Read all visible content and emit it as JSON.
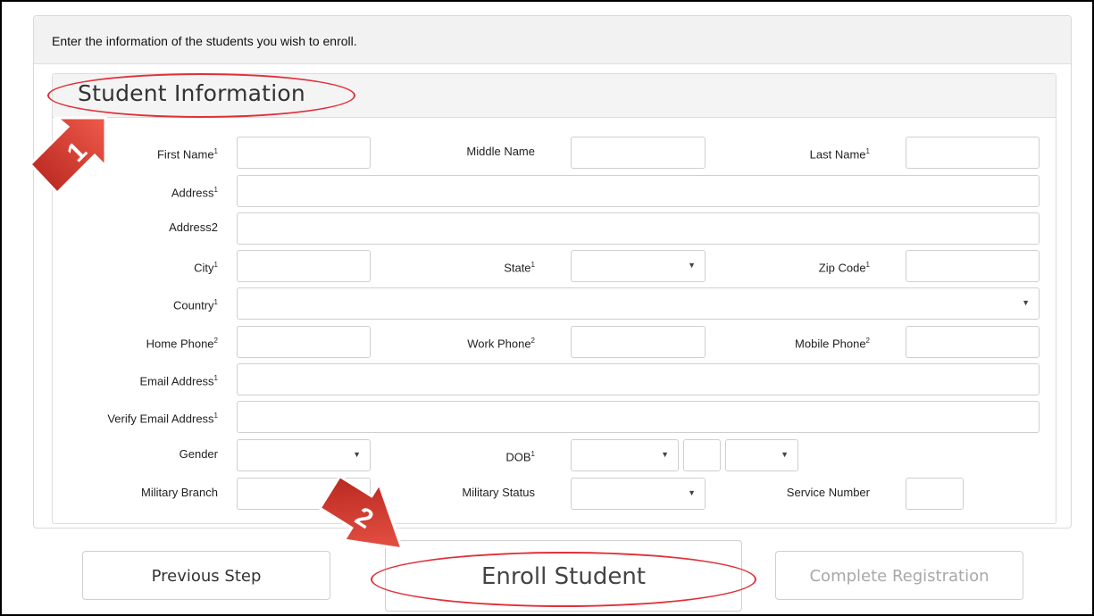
{
  "intro_text": "Enter the information of the students you wish to enroll.",
  "section_title": "Student Information",
  "required_mark": "1",
  "phone_mark": "2",
  "labels": {
    "first_name": "First Name",
    "middle_name": "Middle Name",
    "last_name": "Last Name",
    "address": "Address",
    "address2": "Address2",
    "city": "City",
    "state": "State",
    "zip_code": "Zip Code",
    "country": "Country",
    "home_phone": "Home Phone",
    "work_phone": "Work Phone",
    "mobile_phone": "Mobile Phone",
    "email": "Email Address",
    "verify_email": "Verify Email Address",
    "gender": "Gender",
    "dob": "DOB",
    "military_branch": "Military Branch",
    "military_status": "Military Status",
    "service_number": "Service Number"
  },
  "buttons": {
    "previous": "Previous Step",
    "enroll": "Enroll Student",
    "complete": "Complete Registration"
  },
  "callouts": {
    "one": "1",
    "two": "2"
  },
  "colors": {
    "highlight": "#e0303a",
    "arrow": "#d9342b"
  }
}
